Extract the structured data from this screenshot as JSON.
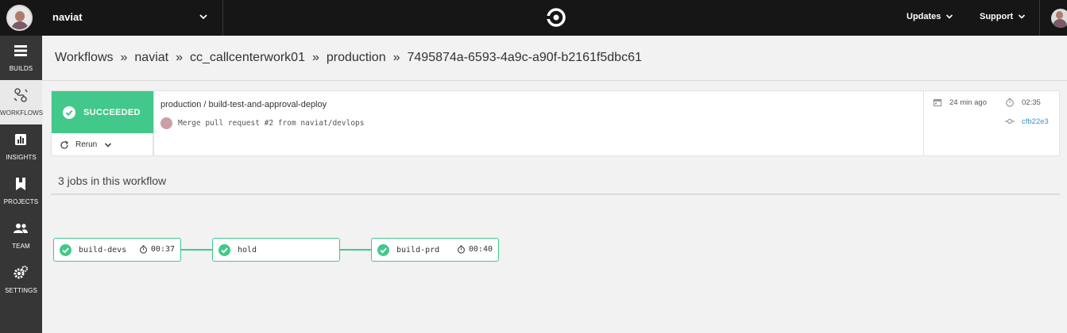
{
  "topbar": {
    "org_name": "naviat",
    "nav": [
      {
        "label": "Updates",
        "icon": "chevron-down-icon"
      },
      {
        "label": "Support",
        "icon": "chevron-down-icon"
      }
    ],
    "logo_icon": "circleci-logo-icon"
  },
  "sidebar": {
    "items": [
      {
        "label": "BUILDS",
        "icon": "builds-icon",
        "active": false
      },
      {
        "label": "WORKFLOWS",
        "icon": "workflows-icon",
        "active": true
      },
      {
        "label": "INSIGHTS",
        "icon": "insights-icon",
        "active": false
      },
      {
        "label": "PROJECTS",
        "icon": "projects-icon",
        "active": false
      },
      {
        "label": "TEAM",
        "icon": "team-icon",
        "active": false
      },
      {
        "label": "SETTINGS",
        "icon": "settings-icon",
        "active": false
      }
    ]
  },
  "breadcrumb": {
    "items": [
      "Workflows",
      "naviat",
      "cc_callcenterwork01",
      "production",
      "7495874a-6593-4a9c-a90f-b2161f5dbc61"
    ],
    "separator": "»"
  },
  "workflow": {
    "status": "SUCCEEDED",
    "rerun_label": "Rerun",
    "name": "production / build-test-and-approval-deploy",
    "commit_message": "Merge pull request #2 from naviat/devlops",
    "time_ago": "24 min ago",
    "duration": "02:35",
    "commit_hash": "cfb22e3"
  },
  "jobs": {
    "title": "3 jobs in this workflow",
    "items": [
      {
        "name": "build-devs",
        "duration": "00:37"
      },
      {
        "name": "hold",
        "duration": ""
      },
      {
        "name": "build-prd",
        "duration": "00:40"
      }
    ]
  },
  "colors": {
    "success": "#42c88a",
    "topbar": "#161616",
    "sidebar": "#363636",
    "link": "#3b8fd1"
  }
}
